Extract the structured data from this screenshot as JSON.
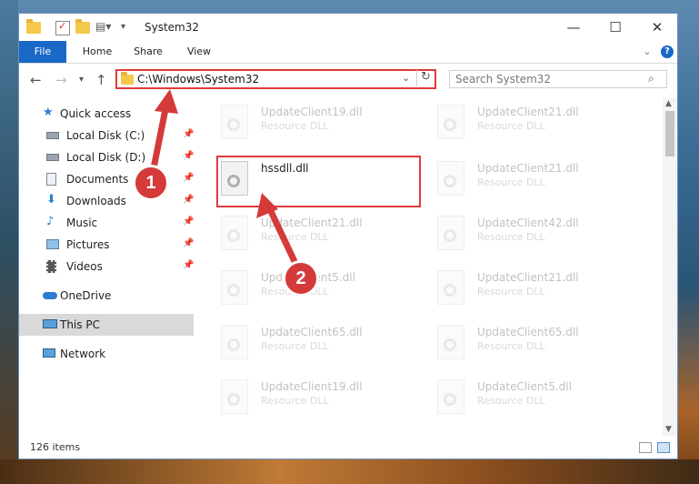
{
  "window": {
    "title": "System32",
    "minimize": "—",
    "maximize": "☐",
    "close": "✕"
  },
  "ribbon": {
    "tabs": [
      "File",
      "Home",
      "Share",
      "View"
    ],
    "expand": "⌄",
    "help": "?"
  },
  "address": {
    "path": "C:\\Windows\\System32",
    "search_placeholder": "Search System32"
  },
  "nav": {
    "items": [
      {
        "label": "Quick access",
        "icon": "star-icon"
      },
      {
        "label": "Local Disk (C:)",
        "icon": "drive-icon",
        "pinned": true
      },
      {
        "label": "Local Disk (D:)",
        "icon": "drive-icon",
        "pinned": true
      },
      {
        "label": "Documents",
        "icon": "documents-icon",
        "pinned": true
      },
      {
        "label": "Downloads",
        "icon": "downloads-icon",
        "pinned": true
      },
      {
        "label": "Music",
        "icon": "music-icon",
        "pinned": true
      },
      {
        "label": "Pictures",
        "icon": "pictures-icon",
        "pinned": true
      },
      {
        "label": "Videos",
        "icon": "videos-icon",
        "pinned": true
      },
      {
        "label": "OneDrive",
        "icon": "cloud-icon"
      },
      {
        "label": "This PC",
        "icon": "computer-icon",
        "selected": true
      },
      {
        "label": "Network",
        "icon": "network-icon"
      }
    ]
  },
  "files": [
    {
      "name": "UpdateClient19.dll",
      "type": "Resource DLL"
    },
    {
      "name": "UpdateClient21.dll",
      "type": "Resource DLL"
    },
    {
      "name": "hssdll.dll",
      "type": ""
    },
    {
      "name": "UpdateClient21.dll",
      "type": "Resource DLL"
    },
    {
      "name": "UpdateClient21.dll",
      "type": "Resource DLL"
    },
    {
      "name": "UpdateClient42.dll",
      "type": "Resource DLL"
    },
    {
      "name": "UpdateClient5.dll",
      "type": "Resource DLL"
    },
    {
      "name": "UpdateClient21.dll",
      "type": "Resource DLL"
    },
    {
      "name": "UpdateClient65.dll",
      "type": "Resource DLL"
    },
    {
      "name": "UpdateClient65.dll",
      "type": "Resource DLL"
    },
    {
      "name": "UpdateClient19.dll",
      "type": "Resource DLL"
    },
    {
      "name": "UpdateClient5.dll",
      "type": "Resource DLL"
    }
  ],
  "status": {
    "item_count": "126 items"
  },
  "callouts": {
    "one": "1",
    "two": "2"
  },
  "colors": {
    "accent": "#1a68c6",
    "highlight": "#e03b3b",
    "callout": "#d43a3a"
  }
}
